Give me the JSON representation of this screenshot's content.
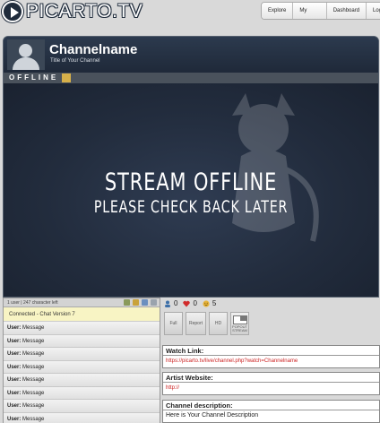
{
  "header": {
    "logo_text": "PICARTO.TV",
    "nav": [
      "Explore",
      "My Channel",
      "Dashboard",
      "Log"
    ]
  },
  "channel": {
    "name": "Channelname",
    "title": "Title of Your Channel",
    "status_label": "OFFLINE",
    "offline_line1": "STREAM OFFLINE",
    "offline_line2": "PLEASE CHECK BACK LATER"
  },
  "chat": {
    "info": "1 user | 247 character left",
    "connected": "Connected - Chat Version 7",
    "messages": [
      {
        "user": "User:",
        "text": "Message"
      },
      {
        "user": "User:",
        "text": "Message"
      },
      {
        "user": "User:",
        "text": "Message"
      },
      {
        "user": "User:",
        "text": "Message"
      },
      {
        "user": "User:",
        "text": "Message"
      },
      {
        "user": "User:",
        "text": "Message"
      },
      {
        "user": "User:",
        "text": "Message"
      },
      {
        "user": "User:",
        "text": "Message"
      }
    ]
  },
  "stats": {
    "viewers": "0",
    "likes": "0",
    "rating": "5"
  },
  "player_buttons": {
    "full": "Full",
    "report": "Report",
    "hd": "HD",
    "popout": "POPOUT STREAM"
  },
  "watch_link": {
    "heading": "Watch Link:",
    "url": "https://picarto.tv/live/channel.php?watch=Channelname"
  },
  "artist_website": {
    "heading": "Artist Website:",
    "url": "http://"
  },
  "channel_description": {
    "heading": "Channel description:",
    "text": "Here is Your Channel Description"
  },
  "colors": {
    "header_dark": "#1f2b3b",
    "player_bg": "#1c2433",
    "link_red": "#cc2222",
    "connected_bg": "#f8f4c4"
  }
}
